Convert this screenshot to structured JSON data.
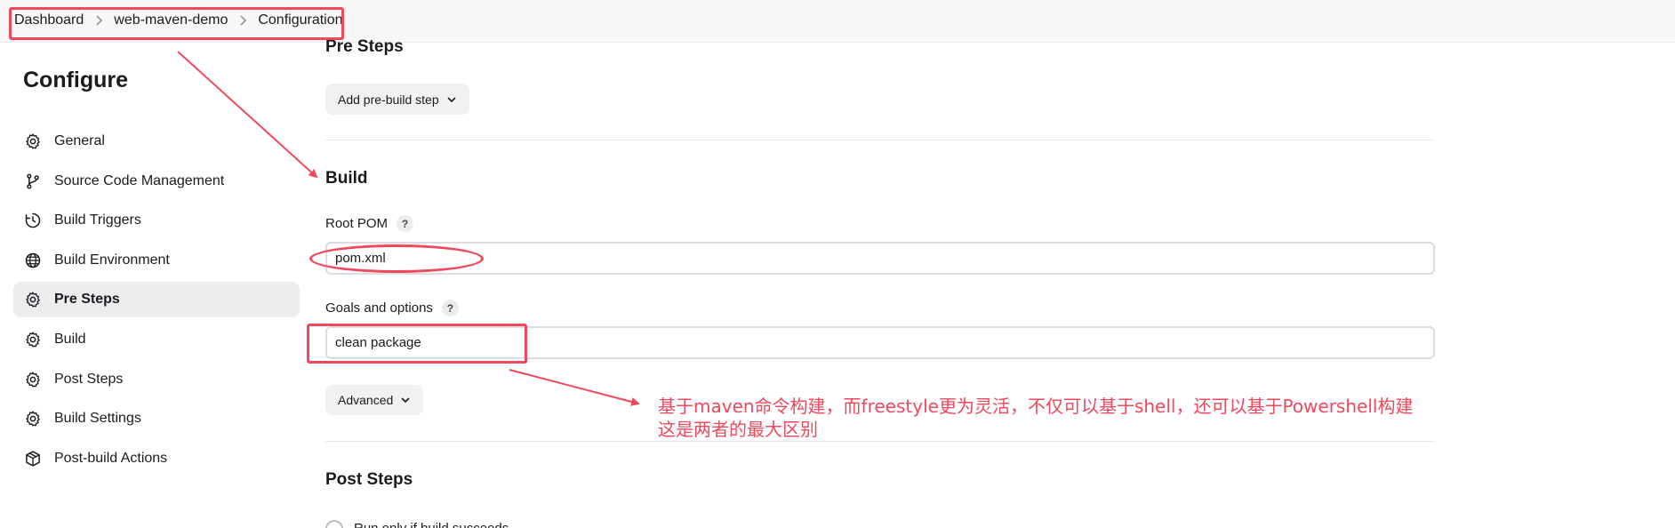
{
  "breadcrumb": {
    "items": [
      "Dashboard",
      "web-maven-demo",
      "Configuration"
    ]
  },
  "sidebar": {
    "title": "Configure",
    "items": [
      {
        "label": "General",
        "icon": "gear-icon"
      },
      {
        "label": "Source Code Management",
        "icon": "branch-icon"
      },
      {
        "label": "Build Triggers",
        "icon": "clock-icon"
      },
      {
        "label": "Build Environment",
        "icon": "globe-icon"
      },
      {
        "label": "Pre Steps",
        "icon": "gear-icon",
        "active": true
      },
      {
        "label": "Build",
        "icon": "gear-icon"
      },
      {
        "label": "Post Steps",
        "icon": "gear-icon"
      },
      {
        "label": "Build Settings",
        "icon": "gear-icon"
      },
      {
        "label": "Post-build Actions",
        "icon": "package-icon"
      }
    ]
  },
  "main": {
    "pre_steps": {
      "title": "Pre Steps",
      "add_button": "Add pre-build step"
    },
    "build": {
      "title": "Build",
      "root_pom_label": "Root POM",
      "root_pom_value": "pom.xml",
      "goals_label": "Goals and options",
      "goals_value": "clean package",
      "help_glyph": "?",
      "advanced_button": "Advanced"
    },
    "post_steps": {
      "title": "Post Steps",
      "radio_label": "Run only if build succeeds"
    }
  },
  "annotation": {
    "line1": "基于maven命令构建，而freestyle更为灵活，不仅可以基于shell，还可以基于Powershell构建",
    "line2": "这是两者的最大区别",
    "color": "#f0485c"
  }
}
